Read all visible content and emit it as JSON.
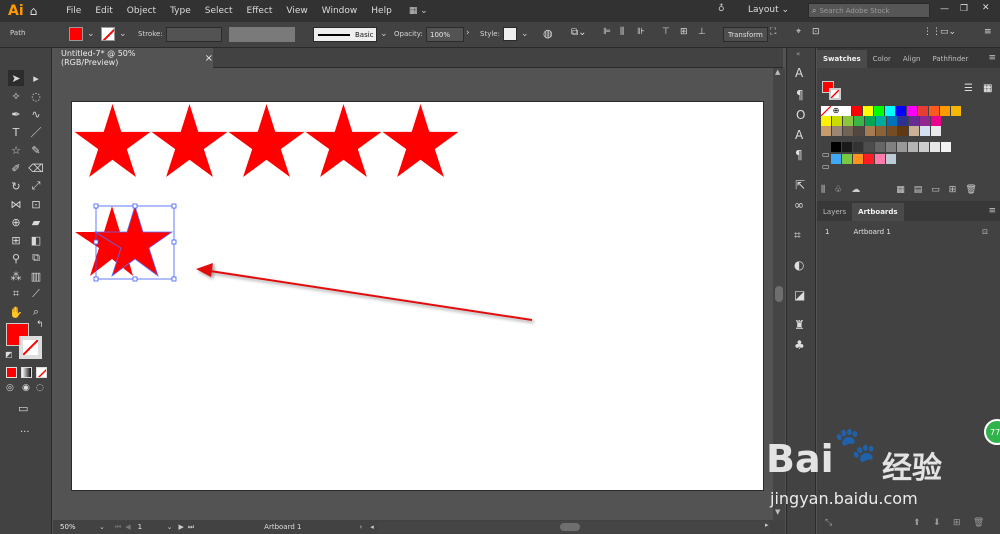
{
  "app": {
    "logo": "Ai"
  },
  "menu": {
    "items": [
      "File",
      "Edit",
      "Object",
      "Type",
      "Select",
      "Effect",
      "View",
      "Window",
      "Help"
    ]
  },
  "menubar_right": {
    "layout": "Layout",
    "search_placeholder": "Search Adobe Stock"
  },
  "control_bar": {
    "selection_type": "Path",
    "fill_color": "#ff0000",
    "stroke_label": "Stroke:",
    "brush_label": "Basic",
    "opacity_label": "Opacity:",
    "opacity_value": "100%",
    "style_label": "Style:",
    "transform_label": "Transform"
  },
  "document": {
    "tab_title": "Untitled-7* @ 50% (RGB/Preview)",
    "close": "×",
    "zoom": "50%",
    "artboard_number": "1",
    "artboard_name": "Artboard 1",
    "star_color": "#ff0000",
    "stars_in_row": 5,
    "arrow_color": "#e01010"
  },
  "tools": {
    "fill_color": "#ff0000",
    "more": "..."
  },
  "swatches_panel": {
    "tabs": [
      "Swatches",
      "Color",
      "Align",
      "Pathfinder"
    ],
    "active_tab": "Swatches",
    "rows": [
      [
        "#ffffff",
        "#ff0000",
        "#ffff00",
        "#00ff00",
        "#00ffff",
        "#0000ff",
        "#ff00ff",
        "#e63c32",
        "#ff5a1e",
        "#ff9a00",
        "#f5b800"
      ],
      [
        "#fff200",
        "#c8dc00",
        "#8cc63e",
        "#39b54a",
        "#00a651",
        "#00a99d",
        "#0072bc",
        "#2e3192",
        "#662d91",
        "#92278f",
        "#ec008c"
      ],
      [
        "#c69c6d",
        "#998675",
        "#736357",
        "#534741",
        "#a67c52",
        "#8c6239",
        "#754c24",
        "#603913",
        "#c7b299",
        "#d4e1f2",
        "#e8e8e8"
      ],
      [
        "#000000",
        "#1a1a1a",
        "#333333",
        "#4d4d4d",
        "#666666",
        "#808080",
        "#999999",
        "#b3b3b3",
        "#cccccc",
        "#e6e6e6",
        "#f2f2f2"
      ],
      [
        "#3fa9f5",
        "#7ac943",
        "#ff931e",
        "#ff1d25",
        "#ff7bac",
        "#bdccd4"
      ]
    ]
  },
  "layers_panel": {
    "tabs": [
      "Layers",
      "Artboards"
    ],
    "active_tab": "Artboards",
    "rows": [
      {
        "index": "1",
        "name": "Artboard 1"
      }
    ]
  },
  "watermark": {
    "brand": "Bai",
    "brand2": "经验",
    "url": "jingyan.baidu.com",
    "badge": "77"
  }
}
